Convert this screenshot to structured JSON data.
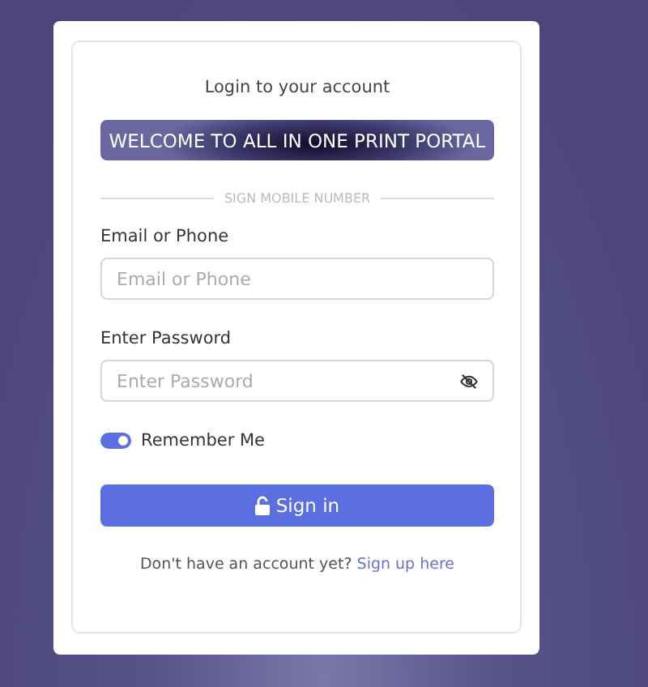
{
  "card": {
    "title": "Login to your account",
    "banner": "WELCOME TO ALL IN ONE PRINT PORTAL",
    "divider": "SIGN MOBILE NUMBER"
  },
  "fields": [
    {
      "label": "Email or Phone",
      "placeholder": "Email or Phone",
      "kind": "text"
    },
    {
      "label": "Enter Password",
      "placeholder": "Enter Password",
      "kind": "password"
    }
  ],
  "remember": {
    "label": "Remember Me",
    "on": true
  },
  "button": "Sign in",
  "footer": {
    "text": "Don't have an account yet?",
    "link": "Sign up here"
  }
}
